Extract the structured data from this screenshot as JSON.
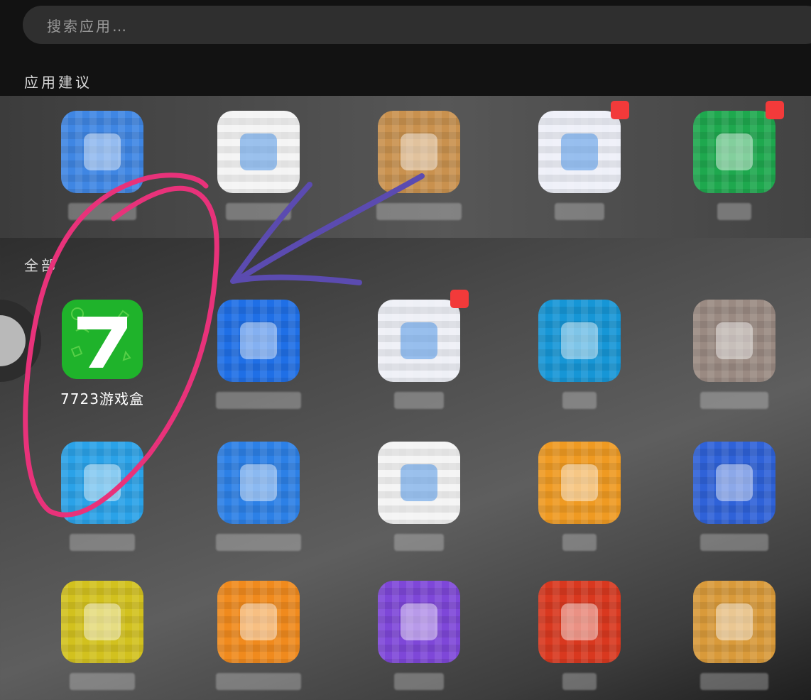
{
  "search": {
    "placeholder": "搜索应用…"
  },
  "sections": {
    "suggested": "应用建议",
    "all": "全部"
  },
  "highlighted_app": {
    "name": "7723游戏盒",
    "icon": "seven-logo-icon",
    "color": "#1fb32b"
  },
  "suggested_apps": [
    {
      "color": "#3f86e3",
      "icon": "blurred-app-icon",
      "badge": false
    },
    {
      "color": "#f4f4f4",
      "icon": "blurred-app-icon",
      "badge": false
    },
    {
      "color": "#c9914e",
      "icon": "blurred-app-icon",
      "badge": false
    },
    {
      "color": "#eef0f8",
      "icon": "blurred-app-icon",
      "badge": true
    },
    {
      "color": "#1ea84e",
      "icon": "blurred-app-icon",
      "badge": true
    }
  ],
  "all_apps": [
    {
      "color": "#1f6fe6",
      "icon": "blurred-app-icon",
      "badge": false
    },
    {
      "color": "#eef0f6",
      "icon": "blurred-app-icon",
      "badge": true
    },
    {
      "color": "#1696d6",
      "icon": "blurred-app-icon",
      "badge": false
    },
    {
      "color": "#9a8a82",
      "icon": "blurred-app-icon",
      "badge": false
    },
    {
      "color": "#2aa2e8",
      "icon": "blurred-app-icon",
      "badge": false
    },
    {
      "color": "#2c80e6",
      "icon": "blurred-app-icon",
      "badge": false
    },
    {
      "color": "#f4f4f4",
      "icon": "blurred-app-icon",
      "badge": false
    },
    {
      "color": "#ef9a22",
      "icon": "blurred-app-icon",
      "badge": false
    },
    {
      "color": "#2f62d8",
      "icon": "blurred-app-icon",
      "badge": false
    },
    {
      "color": "#d2c11e",
      "icon": "blurred-app-icon",
      "badge": false
    },
    {
      "color": "#f08a1d",
      "icon": "blurred-app-icon",
      "badge": false
    },
    {
      "color": "#7e47d8",
      "icon": "blurred-app-icon",
      "badge": false
    },
    {
      "color": "#d9381f",
      "icon": "blurred-app-icon",
      "badge": false
    },
    {
      "color": "#d99a3a",
      "icon": "blurred-app-icon",
      "badge": false
    }
  ],
  "annotation_colors": {
    "circle": "#e8327a",
    "arrow": "#5b4bb0"
  }
}
